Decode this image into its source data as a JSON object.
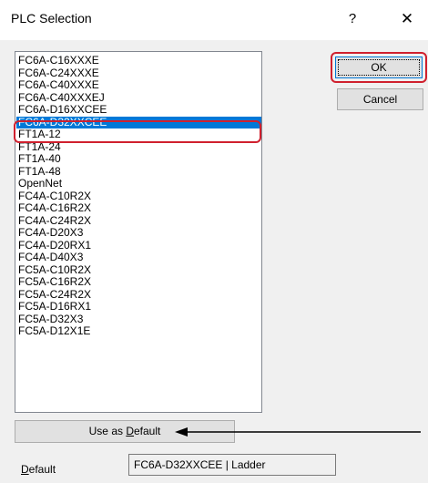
{
  "window": {
    "title": "PLC Selection",
    "help_glyph": "?",
    "close_glyph": "✕"
  },
  "plc_list": {
    "items": [
      "FC6A-C16XXXE",
      "FC6A-C24XXXE",
      "FC6A-C40XXXE",
      "FC6A-C40XXXEJ",
      "FC6A-D16XXCEE",
      "FC6A-D32XXCEE",
      "FT1A-12",
      "FT1A-24",
      "FT1A-40",
      "FT1A-48",
      "OpenNet",
      "FC4A-C10R2X",
      "FC4A-C16R2X",
      "FC4A-C24R2X",
      "FC4A-D20X3",
      "FC4A-D20RX1",
      "FC4A-D40X3",
      "FC5A-C10R2X",
      "FC5A-C16R2X",
      "FC5A-C24R2X",
      "FC5A-D16RX1",
      "FC5A-D32X3",
      "FC5A-D12X1E"
    ],
    "selected": "FC6A-D32XXCEE"
  },
  "buttons": {
    "ok": "OK",
    "cancel": "Cancel",
    "use_default_prefix": "Use as ",
    "use_default_underlined": "D",
    "use_default_suffix": "efault"
  },
  "default_field": {
    "label_underlined": "D",
    "label_rest": "efault",
    "value": "FC6A-D32XXCEE | Ladder"
  },
  "annotation_colors": {
    "highlight": "#d0202e",
    "selection": "#0078d7"
  },
  "icons": {
    "arrow": "left-arrow-icon"
  }
}
